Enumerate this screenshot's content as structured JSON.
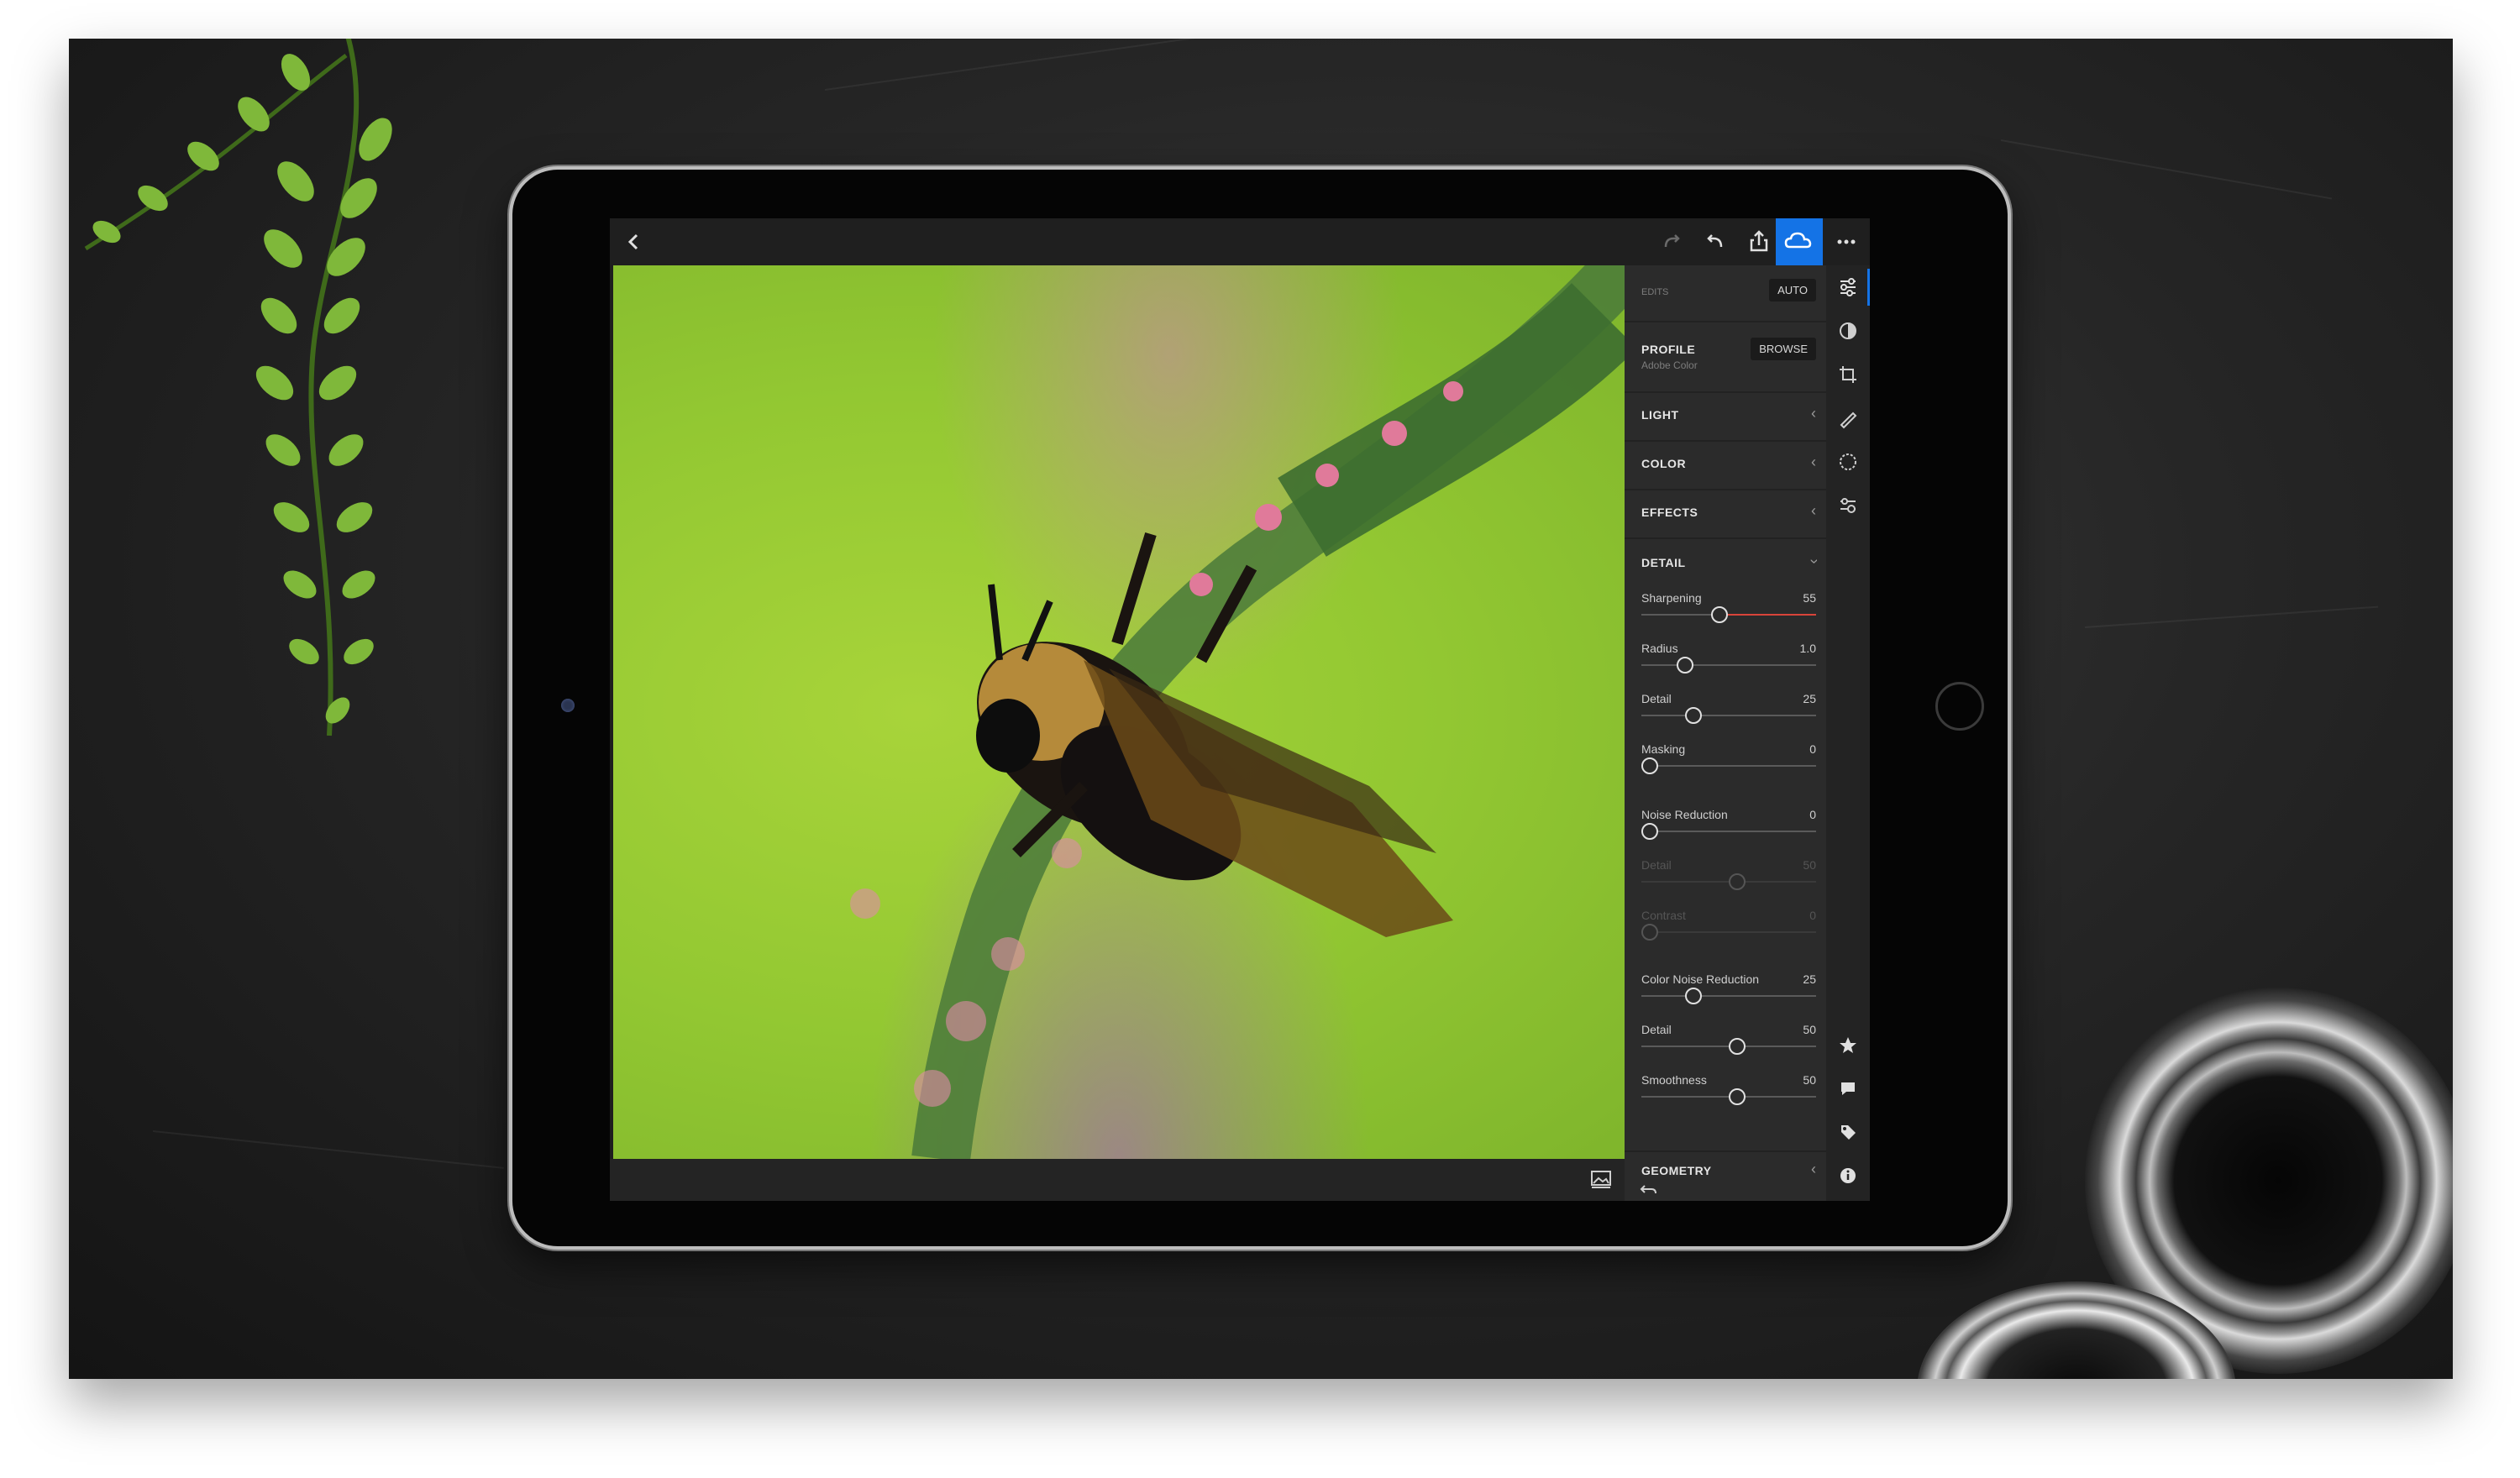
{
  "toolbar": {
    "back_icon": "chevron-left-icon",
    "redo_icon": "redo-icon",
    "undo_icon": "undo-icon",
    "share_icon": "share-icon",
    "cloud_icon": "cloud-sync-icon",
    "more_icon": "more-icon"
  },
  "panel": {
    "edits": {
      "label": "EDITS",
      "auto_label": "AUTO"
    },
    "profile": {
      "label": "PROFILE",
      "value": "Adobe Color",
      "browse_label": "BROWSE"
    },
    "sections": {
      "light": "LIGHT",
      "color": "COLOR",
      "effects": "EFFECTS",
      "detail": "DETAIL",
      "geometry": "GEOMETRY"
    },
    "sliders": [
      {
        "label": "Sharpening",
        "value": "55",
        "pos": 0.4
      },
      {
        "label": "Radius",
        "value": "1.0",
        "pos": 0.2
      },
      {
        "label": "Detail",
        "value": "25",
        "pos": 0.25
      },
      {
        "label": "Masking",
        "value": "0",
        "pos": 0.0
      },
      {
        "label": "Noise Reduction",
        "value": "0",
        "pos": 0.0
      },
      {
        "label": "Detail",
        "value": "50",
        "pos": 0.5
      },
      {
        "label": "Contrast",
        "value": "0",
        "pos": 0.0
      },
      {
        "label": "Color Noise Reduction",
        "value": "25",
        "pos": 0.25
      },
      {
        "label": "Detail",
        "value": "50",
        "pos": 0.5
      },
      {
        "label": "Smoothness",
        "value": "50",
        "pos": 0.5
      }
    ]
  },
  "colors": {
    "accent": "#1473e6",
    "panel": "#2b2b2b",
    "sharpening_track": "#d9443a"
  }
}
